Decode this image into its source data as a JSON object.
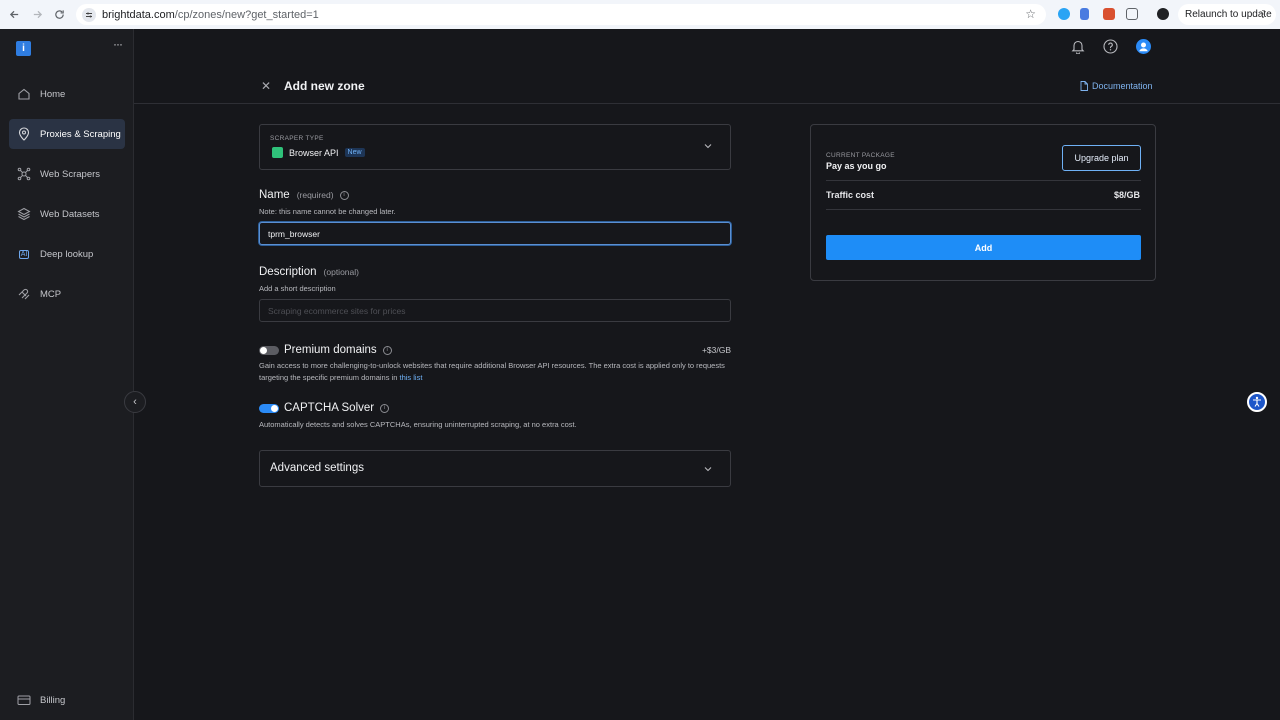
{
  "browser": {
    "url_host": "brightdata.com",
    "url_path": "/cp/zones/new?get_started=1",
    "relaunch_label": "Relaunch to update",
    "relaunch_menu": "⋮"
  },
  "sidebar": {
    "logo_letter": "i",
    "more": "···",
    "items": [
      {
        "label": "Home",
        "icon": "home-icon"
      },
      {
        "label": "Proxies & Scraping",
        "icon": "location-pin-icon",
        "active": true
      },
      {
        "label": "Web Scrapers",
        "icon": "network-icon"
      },
      {
        "label": "Web Datasets",
        "icon": "layers-icon"
      },
      {
        "label": "Deep lookup",
        "icon": "ai-icon",
        "icon_text": "AI"
      },
      {
        "label": "MCP",
        "icon": "mcp-icon"
      }
    ],
    "billing": {
      "label": "Billing",
      "icon": "credit-card-icon"
    },
    "collapse": "‹"
  },
  "header": {
    "close": "✕",
    "title": "Add new zone",
    "doc_link": "Documentation"
  },
  "scraper_type": {
    "label": "SCRAPER TYPE",
    "value": "Browser API",
    "badge": "New"
  },
  "name_field": {
    "title": "Name",
    "hint": "(required)",
    "note": "Note: this name cannot be changed later.",
    "value": "tprm_browser",
    "info": "i"
  },
  "description_field": {
    "title": "Description",
    "hint": "(optional)",
    "note": "Add a short description",
    "placeholder": "Scraping ecommerce sites for prices"
  },
  "premium_domains": {
    "title": "Premium domains",
    "enabled": false,
    "price": "+$3/GB",
    "desc_prefix": "Gain access to more challenging-to-unlock websites that require additional Browser API resources. The extra cost is applied only to requests targeting the specific premium domains in ",
    "link": "this list"
  },
  "captcha_solver": {
    "title": "CAPTCHA Solver",
    "enabled": true,
    "desc": "Automatically detects and solves CAPTCHAs, ensuring uninterrupted scraping, at no extra cost."
  },
  "advanced": {
    "title": "Advanced settings"
  },
  "package": {
    "label": "CURRENT PACKAGE",
    "value": "Pay as you go",
    "upgrade": "Upgrade plan",
    "traffic_label": "Traffic cost",
    "traffic_value": "$8/GB",
    "add": "Add"
  },
  "colors": {
    "accent": "#1e8df7",
    "link": "#6fb1f6",
    "background": "#16171b",
    "sidebar": "#1c1d21"
  }
}
